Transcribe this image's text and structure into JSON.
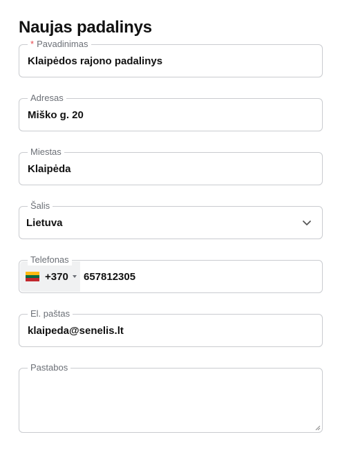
{
  "form": {
    "title": "Naujas padalinys",
    "name": {
      "label": "Pavadinimas",
      "required_mark": "*",
      "value": "Klaipėdos rajono padalinys"
    },
    "address": {
      "label": "Adresas",
      "value": "Miško g. 20"
    },
    "city": {
      "label": "Miestas",
      "value": "Klaipėda"
    },
    "country": {
      "label": "Šalis",
      "selected": "Lietuva",
      "icon": "chevron-down-icon"
    },
    "phone": {
      "label": "Telefonas",
      "country_flag": "lithuania-flag-icon",
      "flag_colors": [
        "#FDB913",
        "#006A44",
        "#C1272D"
      ],
      "dial_code": "+370",
      "number": "657812305"
    },
    "email": {
      "label": "El. paštas",
      "value": "klaipeda@senelis.lt"
    },
    "notes": {
      "label": "Pastabos",
      "value": ""
    }
  },
  "colors": {
    "border": "#c9cbcf",
    "label": "#6b6f76",
    "required": "#e5484d",
    "prefix_bg": "#f0f1f2"
  }
}
